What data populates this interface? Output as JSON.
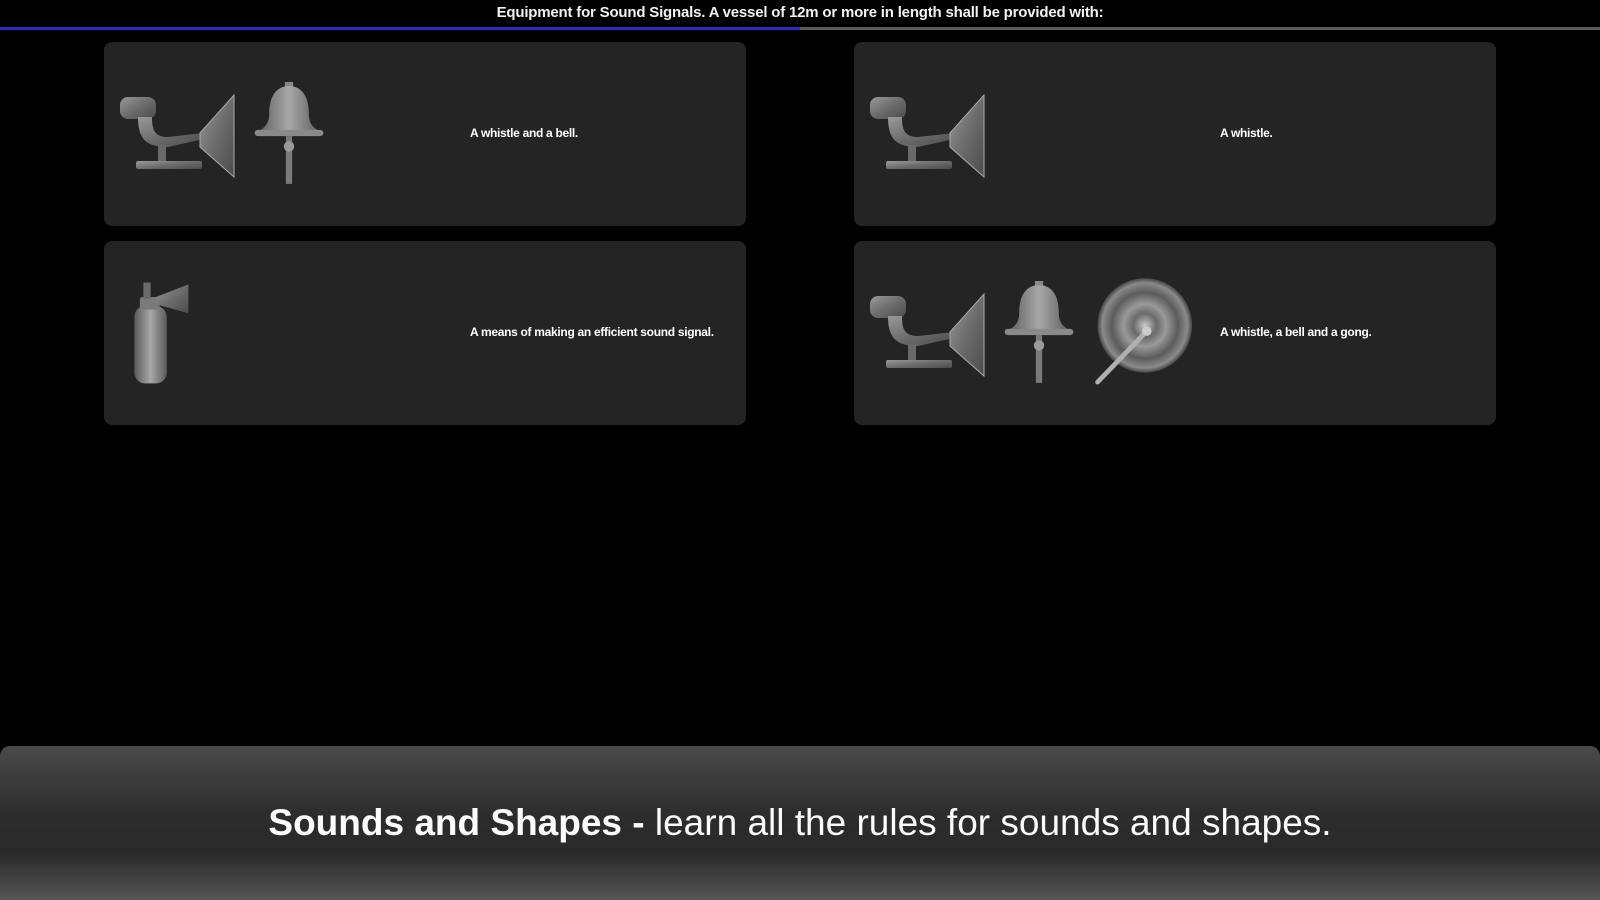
{
  "quiz": {
    "question": "Equipment for Sound Signals. A vessel of 12m or more in length shall be provided with:",
    "progress": 0.5
  },
  "options": [
    {
      "id": "a",
      "answer": "A whistle and a bell.",
      "icons": [
        "whistle-icon",
        "bell-icon"
      ]
    },
    {
      "id": "b",
      "answer": "A whistle.",
      "icons": [
        "whistle-icon"
      ]
    },
    {
      "id": "c",
      "answer": "A means of making an efficient sound signal.",
      "icons": [
        "air-horn-icon"
      ]
    },
    {
      "id": "d",
      "answer": "A whistle, a bell and a gong.",
      "icons": [
        "whistle-icon",
        "bell-icon",
        "gong-icon"
      ]
    }
  ],
  "banner": {
    "title": "Sounds and Shapes -",
    "subtitle": " learn all the rules for sounds and shapes."
  },
  "colors": {
    "background": "#000000",
    "card": "#242424",
    "progress_fill": "#2b2bd0",
    "progress_track": "#5a5a5a"
  }
}
